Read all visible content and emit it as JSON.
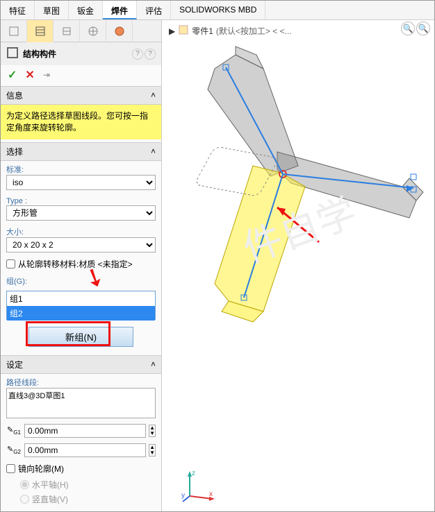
{
  "tabs": [
    "特征",
    "草图",
    "钣金",
    "焊件",
    "评估",
    "SOLIDWORKS MBD"
  ],
  "active_tab": "焊件",
  "feature": {
    "title": "结构构件",
    "info_header": "信息",
    "info_msg": "为定义路径选择草图线段。您可按一指定角度来旋转轮廓。",
    "selection_header": "选择",
    "standard_label": "标准:",
    "standard_value": "iso",
    "type_label": "Type :",
    "type_value": "方形管",
    "size_label": "大小:",
    "size_value": "20 x 20 x 2",
    "transfer_material": "从轮廓转移材料:材质 <未指定>",
    "group_label": "组(G):",
    "groups": [
      "组1",
      "组2"
    ],
    "new_group_btn": "新组(N)",
    "settings_header": "设定",
    "path_label": "路径线段:",
    "path_value": "直线3@3D草图1",
    "g1_value": "0.00mm",
    "g2_value": "0.00mm",
    "mirror_label": "镜向轮廓(M)",
    "horiz_axis": "水平轴(H)",
    "vert_axis": "竖直轴(V)"
  },
  "breadcrumb": {
    "part": "零件1",
    "config": "(默认<按加工> < <..."
  },
  "axes": {
    "x": "x",
    "y": "y",
    "z": "z"
  }
}
